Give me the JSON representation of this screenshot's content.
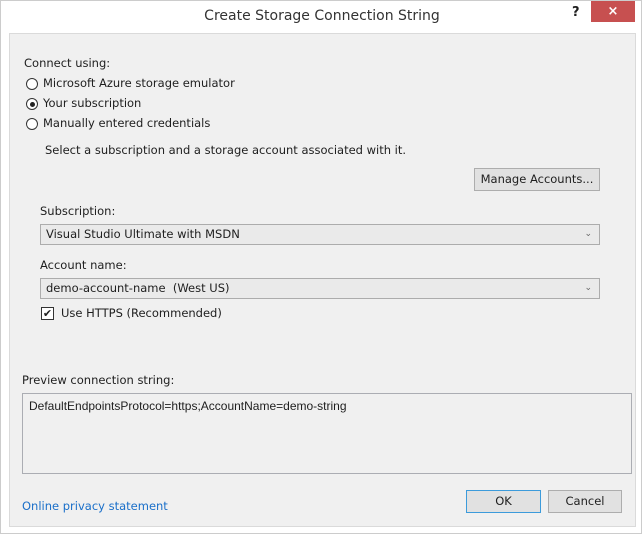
{
  "window": {
    "title": "Create Storage Connection String",
    "help_label": "?",
    "close_label": "×"
  },
  "connect": {
    "label": "Connect using:",
    "options": [
      {
        "label": "Microsoft Azure storage emulator",
        "selected": false
      },
      {
        "label": "Your subscription",
        "selected": true
      },
      {
        "label": "Manually entered credentials",
        "selected": false
      }
    ],
    "instruction": "Select a subscription and a storage account associated with it."
  },
  "manage_accounts_label": "Manage Accounts...",
  "subscription": {
    "label": "Subscription:",
    "value": "Visual Studio Ultimate with MSDN"
  },
  "account": {
    "label": "Account name:",
    "value": "demo-account-name  (West US)"
  },
  "https": {
    "label": "Use HTTPS (Recommended)",
    "checked": true,
    "check_glyph": "✔"
  },
  "preview": {
    "label": "Preview connection string:",
    "value": "DefaultEndpointsProtocol=https;AccountName=demo-string"
  },
  "footer": {
    "privacy_link": "Online privacy statement",
    "ok_label": "OK",
    "cancel_label": "Cancel"
  },
  "chevron_glyph": "⌄"
}
